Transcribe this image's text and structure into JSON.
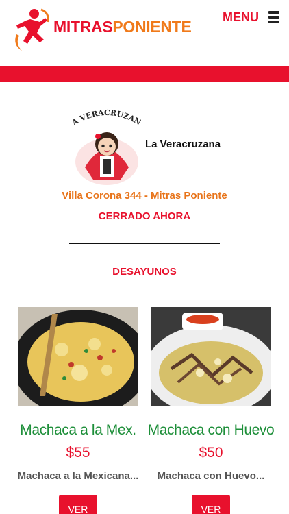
{
  "header": {
    "brand_part1": "MITRAS",
    "brand_part2": "PONIENTE",
    "menu_label": "MENU"
  },
  "restaurant": {
    "logo_text": "LA VERACRUZANA",
    "name": "La Veracruzana",
    "address": "Villa Corona 344 - Mitras Poniente",
    "status": "CERRADO AHORA"
  },
  "section": {
    "title": "DESAYUNOS"
  },
  "items": [
    {
      "title": "Machaca a la Mex.",
      "price": "$55",
      "description": "Machaca a la Mexicana...",
      "button": "VER"
    },
    {
      "title": "Machaca con Huevo",
      "price": "$50",
      "description": "Machaca con Huevo...",
      "button": "VER"
    }
  ],
  "colors": {
    "brand_red": "#e8112d",
    "brand_orange": "#f07a1a",
    "title_green": "#1e8f3a"
  }
}
